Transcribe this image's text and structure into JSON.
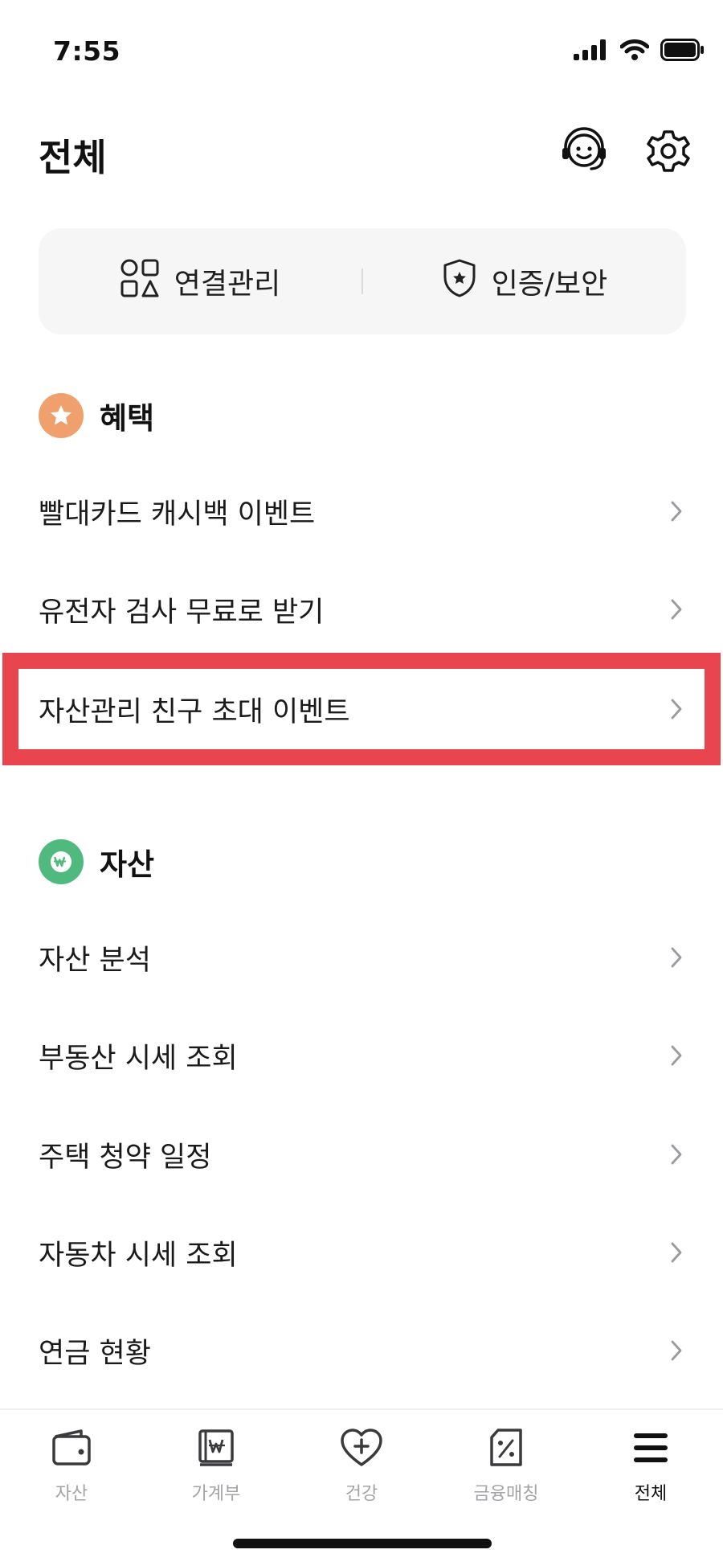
{
  "status_bar": {
    "time": "7:55"
  },
  "header": {
    "title": "전체",
    "agent_icon": "headset-agent-icon",
    "settings_icon": "gear-icon"
  },
  "quick_panel": {
    "items": [
      {
        "label": "연결관리",
        "icon": "connection-shapes-icon"
      },
      {
        "label": "인증/보안",
        "icon": "shield-star-icon"
      }
    ]
  },
  "sections": [
    {
      "title": "혜택",
      "icon": "star-icon",
      "icon_color": "#f0a06c",
      "items": [
        {
          "label": "빨대카드 캐시백 이벤트"
        },
        {
          "label": "유전자 검사 무료로 받기"
        },
        {
          "label": "자산관리 친구 초대 이벤트",
          "highlighted": true
        }
      ]
    },
    {
      "title": "자산",
      "icon": "won-icon",
      "icon_color": "#4fb97e",
      "items": [
        {
          "label": "자산 분석"
        },
        {
          "label": "부동산 시세 조회"
        },
        {
          "label": "주택 청약 일정"
        },
        {
          "label": "자동차 시세 조회"
        },
        {
          "label": "연금 현황"
        }
      ]
    }
  ],
  "highlight_color": "#e8454f",
  "bottom_nav": {
    "active": "전체",
    "tabs": [
      {
        "label": "자산",
        "icon": "wallet-icon"
      },
      {
        "label": "가계부",
        "icon": "ledger-book-icon"
      },
      {
        "label": "건강",
        "icon": "heart-plus-icon"
      },
      {
        "label": "금융매칭",
        "icon": "percent-tag-icon"
      },
      {
        "label": "전체",
        "icon": "menu-icon"
      }
    ]
  }
}
